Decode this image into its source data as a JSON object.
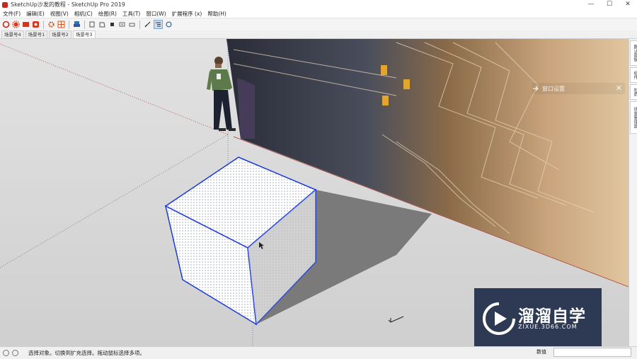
{
  "window": {
    "title": "SketchUp沙发的教程 - SketchUp Pro 2019",
    "controls": {
      "minimize": "—",
      "maximize": "☐",
      "close": "✕"
    }
  },
  "menu": [
    "文件(F)",
    "编辑(E)",
    "视图(V)",
    "相机(C)",
    "绘图(R)",
    "工具(T)",
    "窗口(W)",
    "扩展程序 (x)",
    "帮助(H)"
  ],
  "toolbar_icons": [
    "3d-warehouse-icon",
    "extension-icon",
    "open-folder-icon",
    "paint-icon",
    "gear-icon",
    "grid-icon",
    "print-icon",
    "section-icon",
    "section-icon",
    "section-icon",
    "section-icon",
    "section-icon",
    "axes-icon",
    "outliner-icon",
    "styles-icon"
  ],
  "scene_tabs": [
    "场景号4",
    "场景号1",
    "场景号2",
    "场景号3"
  ],
  "active_scene_tab": 3,
  "window_popup": {
    "label": "窗口设置",
    "close": "✕"
  },
  "right_panel_tabs": [
    "默认面板",
    "组件",
    "材质",
    "场景管理器"
  ],
  "status": {
    "text": "选择对象。切换到扩充选择。拖动鼠标选择多项。",
    "measurements_label": "数值",
    "measurements_value": ""
  },
  "watermark": {
    "title": "溜溜自学",
    "url": "ZIXUE.3D66.COM"
  },
  "colors": {
    "selection_blue": "#1a3ad8",
    "viewport_gray": "#d0d0d0"
  }
}
